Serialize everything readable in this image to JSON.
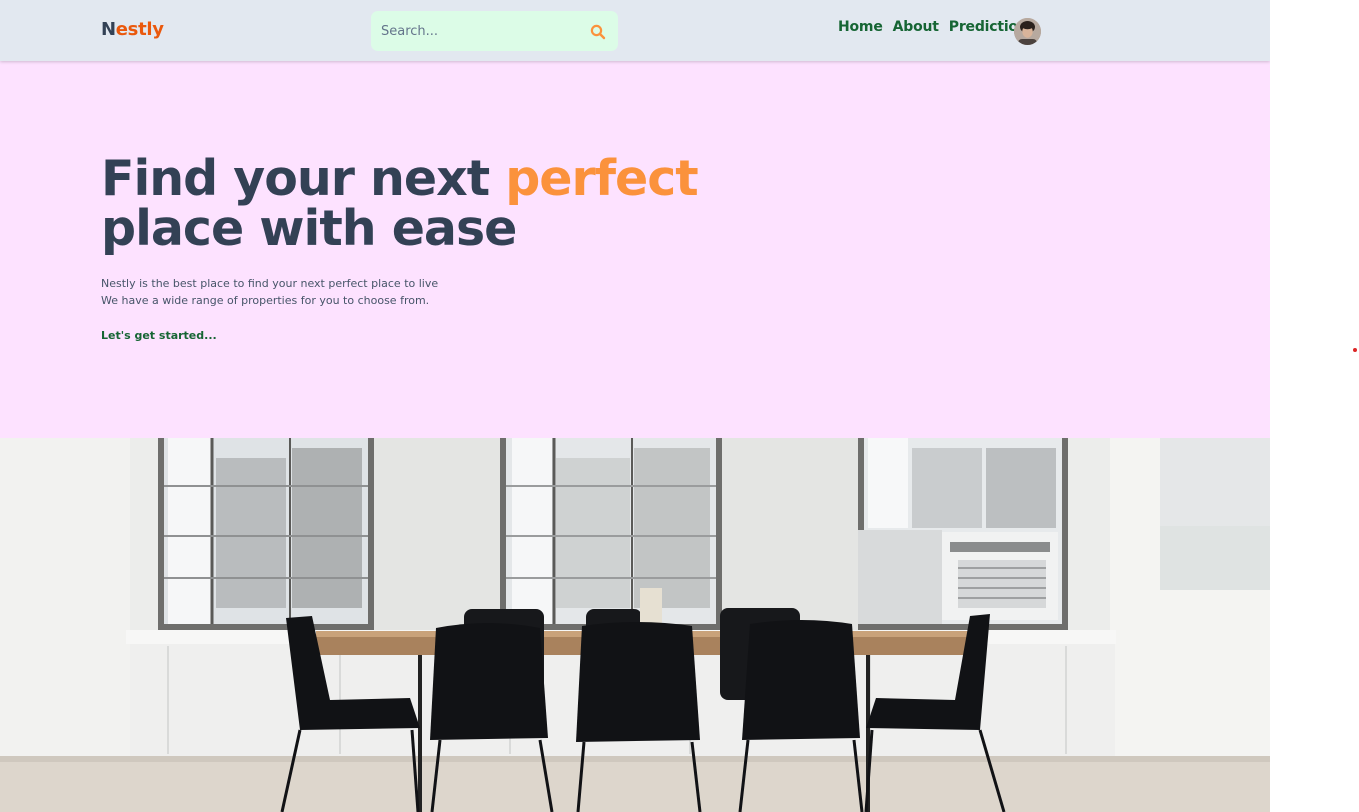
{
  "brand": {
    "first_letter": "N",
    "rest": "estly"
  },
  "search": {
    "placeholder": "Search...",
    "icon": "search-icon"
  },
  "nav": {
    "home": "Home",
    "about": "About",
    "prediction": "Prediction"
  },
  "avatar": {
    "icon": "user-avatar"
  },
  "hero": {
    "title_part1": "Find your next ",
    "title_accent": "perfect",
    "title_part2": "place with ease",
    "desc_line1": "Nestly is the best place to find your next perfect place to live",
    "desc_line2": "We have a wide range of properties for you to choose from.",
    "cta": "Let's get started..."
  },
  "colors": {
    "header_bg": "#e2e8f0",
    "hero_bg": "#fde2ff",
    "brand_dark": "#334155",
    "brand_orange": "#ea580c",
    "accent_orange": "#fb923c",
    "nav_green": "#166534",
    "search_bg": "#dcfce7"
  }
}
